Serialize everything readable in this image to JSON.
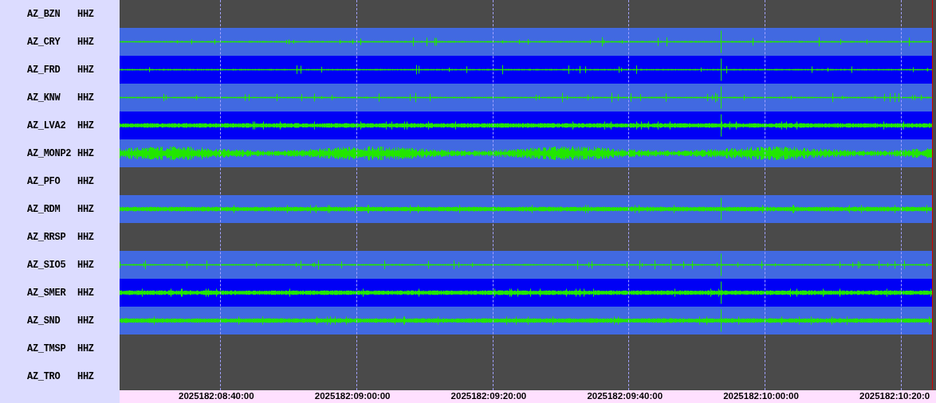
{
  "stations": [
    {
      "station": "AZ_BZN",
      "channel": "HHZ",
      "kind": "empty"
    },
    {
      "station": "AZ_CRY",
      "channel": "HHZ",
      "kind": "trace"
    },
    {
      "station": "AZ_FRD",
      "channel": "HHZ",
      "kind": "trace"
    },
    {
      "station": "AZ_KNW",
      "channel": "HHZ",
      "kind": "trace"
    },
    {
      "station": "AZ_LVA2",
      "channel": "HHZ",
      "kind": "band"
    },
    {
      "station": "AZ_MONP2",
      "channel": "HHZ",
      "kind": "noise"
    },
    {
      "station": "AZ_PFO",
      "channel": "HHZ",
      "kind": "empty"
    },
    {
      "station": "AZ_RDM",
      "channel": "HHZ",
      "kind": "band"
    },
    {
      "station": "AZ_RRSP",
      "channel": "HHZ",
      "kind": "empty"
    },
    {
      "station": "AZ_SIO5",
      "channel": "HHZ",
      "kind": "trace"
    },
    {
      "station": "AZ_SMER",
      "channel": "HHZ",
      "kind": "band"
    },
    {
      "station": "AZ_SND",
      "channel": "HHZ",
      "kind": "band"
    },
    {
      "station": "AZ_TMSP",
      "channel": "HHZ",
      "kind": "empty"
    },
    {
      "station": "AZ_TRO",
      "channel": "HHZ",
      "kind": "empty"
    }
  ],
  "time_axis": {
    "labels": [
      "2025182:08:40:00",
      "2025182:09:00:00",
      "2025182:09:20:00",
      "2025182:09:40:00",
      "2025182:10:00:00",
      "2025182:10:20:0"
    ]
  }
}
